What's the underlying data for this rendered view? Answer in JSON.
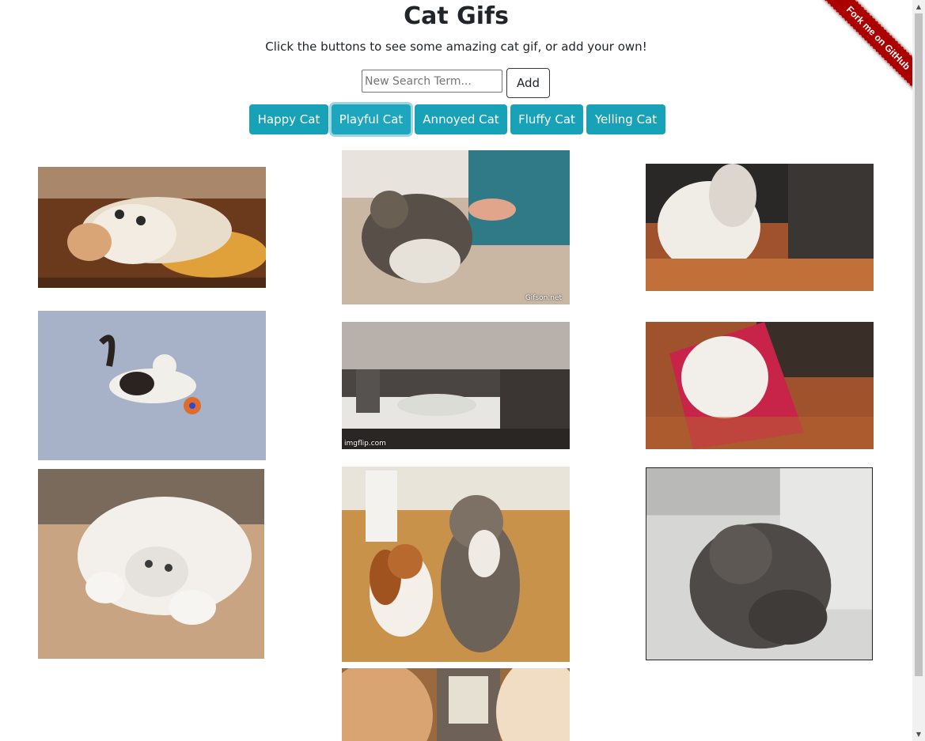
{
  "header": {
    "title": "Cat Gifs",
    "subtitle": "Click the buttons to see some amazing cat gif, or add your own!"
  },
  "search": {
    "placeholder": "New Search Term...",
    "value": "",
    "add_label": "Add"
  },
  "topics": [
    "Happy Cat",
    "Playful Cat",
    "Annoyed Cat",
    "Fluffy Cat",
    "Yelling Cat"
  ],
  "focused_topic": "Playful Cat",
  "ribbon": {
    "label": "Fork me on GitHub"
  },
  "gifs": [
    {
      "watermark": ""
    },
    {
      "watermark": "Gifson.net"
    },
    {
      "watermark": ""
    },
    {
      "watermark": ""
    },
    {
      "watermark": "imgflip.com"
    },
    {
      "watermark": ""
    },
    {
      "watermark": ""
    },
    {
      "watermark": ""
    },
    {
      "watermark": ""
    },
    {
      "watermark": ""
    }
  ],
  "colors": {
    "accent": "#17a2b8",
    "ribbon": "#aa0000"
  },
  "icons": {
    "scroll_up": "scroll-up-arrow-icon",
    "scroll_down": "scroll-down-arrow-icon"
  }
}
